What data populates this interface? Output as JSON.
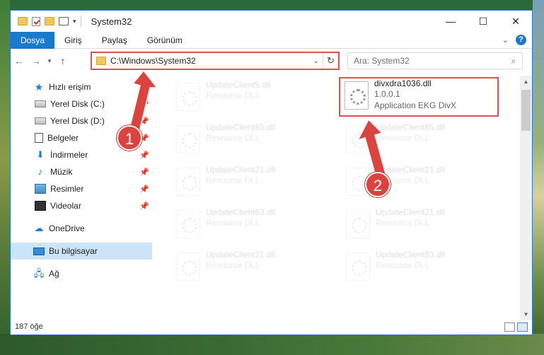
{
  "window": {
    "title": "System32"
  },
  "ribbon": {
    "tabs": [
      "Dosya",
      "Giriş",
      "Paylaş",
      "Görünüm"
    ],
    "active_tab": "Dosya"
  },
  "address": {
    "path": "C:\\Windows\\System32",
    "search_placeholder": "Ara: System32"
  },
  "nav": {
    "quick_access": "Hızlı erişim",
    "items": [
      {
        "label": "Yerel Disk (C:)",
        "icon": "drive-icon",
        "pinned": true
      },
      {
        "label": "Yerel Disk (D:)",
        "icon": "drive-icon",
        "pinned": true
      },
      {
        "label": "Belgeler",
        "icon": "documents-icon",
        "pinned": true
      },
      {
        "label": "İndirmeler",
        "icon": "downloads-icon",
        "pinned": true
      },
      {
        "label": "Müzik",
        "icon": "music-icon",
        "pinned": true
      },
      {
        "label": "Resimler",
        "icon": "pictures-icon",
        "pinned": true
      },
      {
        "label": "Videolar",
        "icon": "videos-icon",
        "pinned": true
      }
    ],
    "onedrive": "OneDrive",
    "this_pc": "Bu bilgisayar",
    "network": "Ağ"
  },
  "files": {
    "target": {
      "name": "divxdra1036.dll",
      "version": "1.0.0.1",
      "description": "Application EKG DivX"
    },
    "faded_left": [
      {
        "name": "UpdateClient5.dll",
        "desc": "Resource DLL"
      },
      {
        "name": "UpdateClient65.dll",
        "desc": "Resource DLL"
      },
      {
        "name": "UpdateClient21.dll",
        "desc": "Resource DLL"
      },
      {
        "name": "UpdateClient63.dll",
        "desc": "Resource DLL"
      },
      {
        "name": "UpdateClient21.dll",
        "desc": "Resource DLL"
      }
    ],
    "faded_right": [
      {
        "name": "UpdateClient65.dll",
        "desc": "Resource DLL"
      },
      {
        "name": "UpdateClient21.dll",
        "desc": "Resource DLL"
      },
      {
        "name": "UpdateClient21.dll",
        "desc": "Resource DLL"
      },
      {
        "name": "UpdateClient63.dll",
        "desc": "Resource DLL"
      }
    ]
  },
  "status": {
    "item_count": "187 öğe"
  },
  "annotations": {
    "step1": "1",
    "step2": "2",
    "color": "#d9443f"
  }
}
